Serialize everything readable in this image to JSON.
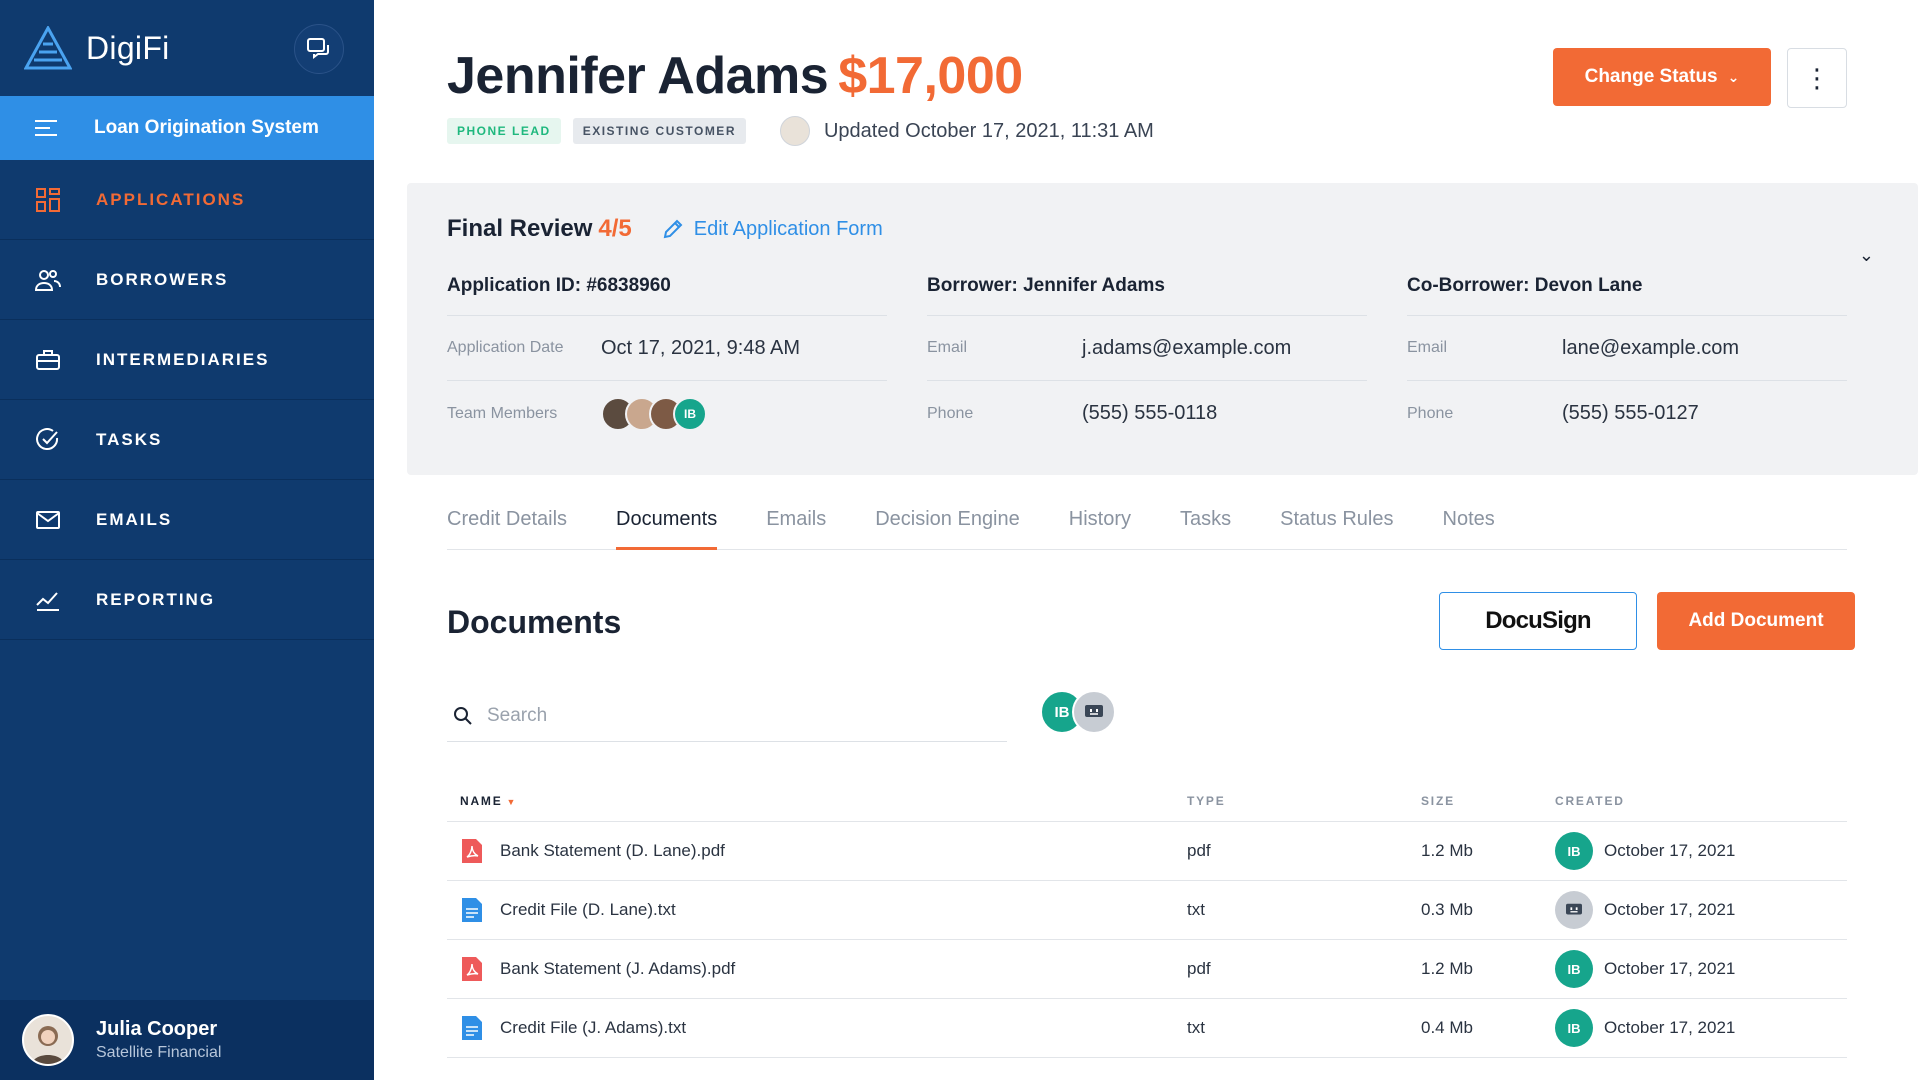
{
  "brand": {
    "name": "DigiFi"
  },
  "sidebar": {
    "section": "Loan Origination System",
    "items": [
      {
        "label": "APPLICATIONS",
        "icon": "grid-icon",
        "active": true
      },
      {
        "label": "BORROWERS",
        "icon": "users-icon"
      },
      {
        "label": "INTERMEDIARIES",
        "icon": "briefcase-icon"
      },
      {
        "label": "TASKS",
        "icon": "check-circle-icon"
      },
      {
        "label": "EMAILS",
        "icon": "mail-icon"
      },
      {
        "label": "REPORTING",
        "icon": "chart-icon"
      }
    ],
    "user": {
      "name": "Julia Cooper",
      "org": "Satellite Financial"
    }
  },
  "header": {
    "name": "Jennifer Adams",
    "amount": "$17,000",
    "tags": [
      "PHONE LEAD",
      "EXISTING CUSTOMER"
    ],
    "updated": "Updated October 17, 2021, 11:31 AM",
    "status_button": "Change Status"
  },
  "review": {
    "stage": "Final Review",
    "step": "4/5",
    "edit_link": "Edit Application Form",
    "application": {
      "title": "Application ID: #6838960",
      "date_label": "Application Date",
      "date_value": "Oct 17, 2021, 9:48 AM",
      "team_label": "Team Members",
      "team_initials": "IB"
    },
    "borrower": {
      "title": "Borrower: Jennifer Adams",
      "email_label": "Email",
      "email": "j.adams@example.com",
      "phone_label": "Phone",
      "phone": "(555) 555-0118"
    },
    "coborrower": {
      "title": "Co-Borrower: Devon Lane",
      "email_label": "Email",
      "email": "lane@example.com",
      "phone_label": "Phone",
      "phone": "(555) 555-0127"
    }
  },
  "tabs": [
    "Credit Details",
    "Documents",
    "Emails",
    "Decision Engine",
    "History",
    "Tasks",
    "Status Rules",
    "Notes"
  ],
  "documents": {
    "title": "Documents",
    "docusign_label": "DocuSign",
    "add_label": "Add Document",
    "search_placeholder": "Search",
    "filter_initials": "IB",
    "columns": {
      "name": "NAME",
      "type": "TYPE",
      "size": "SIZE",
      "created": "CREATED"
    },
    "rows": [
      {
        "name": "Bank Statement (D. Lane).pdf",
        "type": "pdf",
        "size": "1.2 Mb",
        "creator": "IB",
        "created": "October 17, 2021"
      },
      {
        "name": "Credit File (D. Lane).txt",
        "type": "txt",
        "size": "0.3 Mb",
        "creator": "bot",
        "created": "October 17, 2021"
      },
      {
        "name": "Bank Statement (J. Adams).pdf",
        "type": "pdf",
        "size": "1.2 Mb",
        "creator": "IB",
        "created": "October 17, 2021"
      },
      {
        "name": "Credit File (J. Adams).txt",
        "type": "txt",
        "size": "0.4 Mb",
        "creator": "IB",
        "created": "October 17, 2021"
      }
    ]
  },
  "colors": {
    "sidebar": "#0f3a6e",
    "accent": "#f26a35",
    "link": "#2f8fe6",
    "teal": "#16a58c"
  }
}
